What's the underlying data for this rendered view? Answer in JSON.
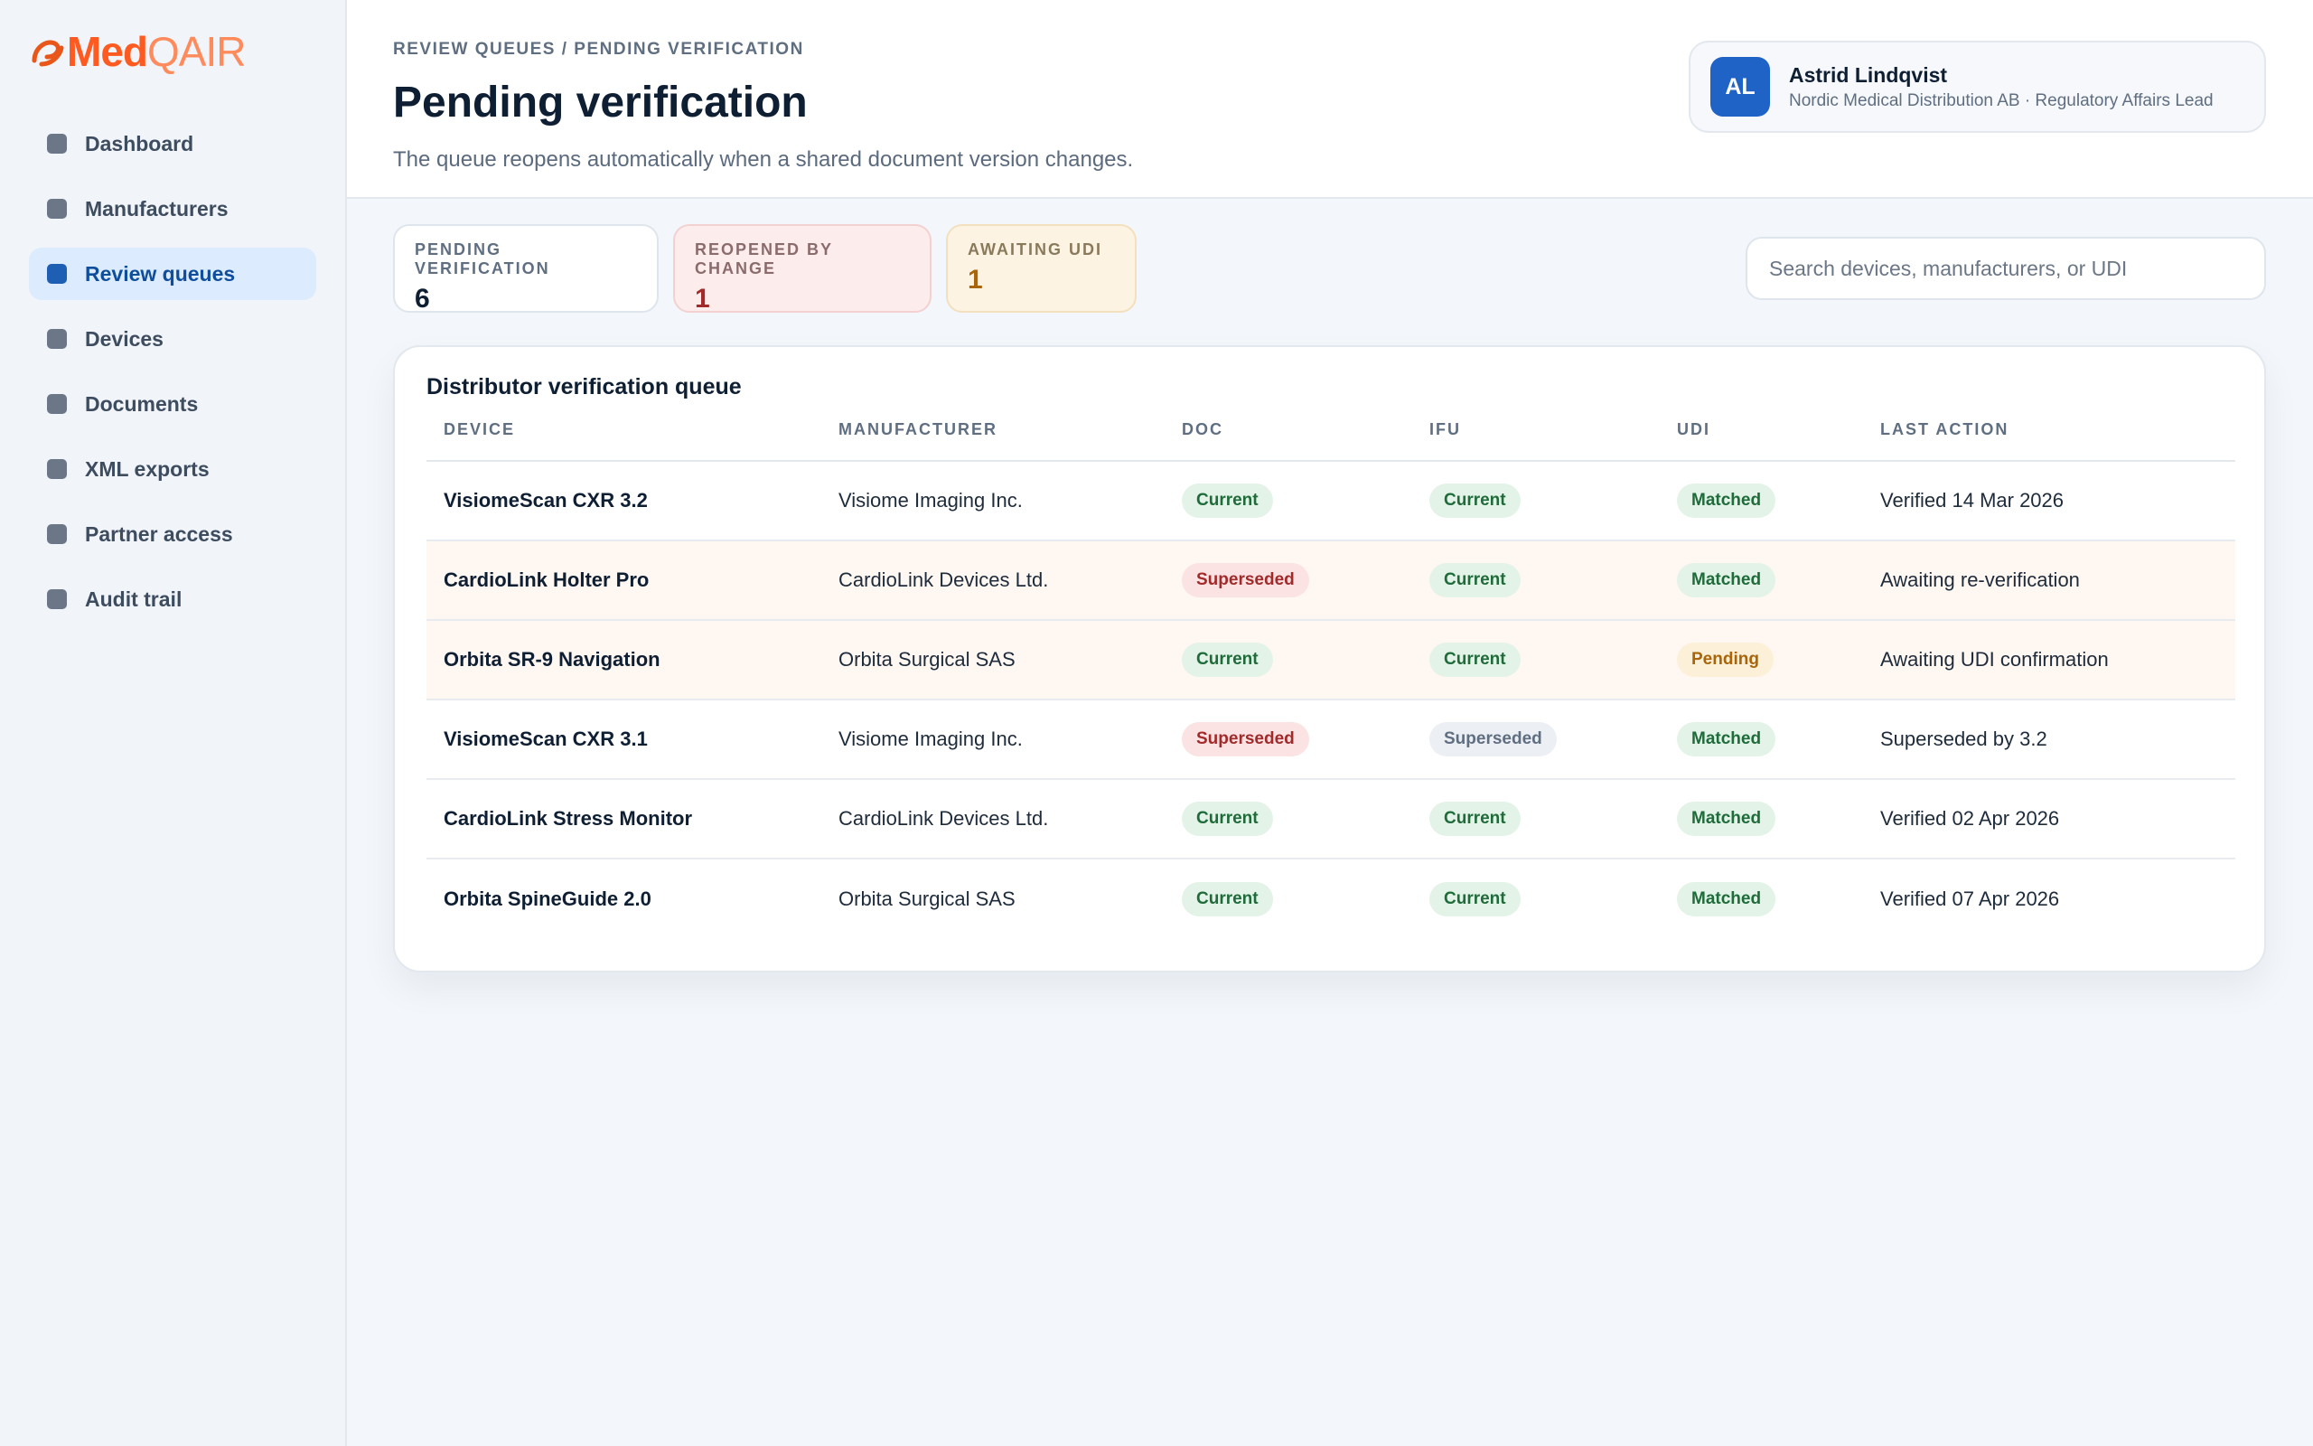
{
  "brand": {
    "name_part1": "Med",
    "name_part2": "QAIR",
    "colors": {
      "primary": "#ff5a1f",
      "secondary": "#ff8a5c"
    }
  },
  "sidebar": {
    "items": [
      {
        "label": "Dashboard",
        "active": false
      },
      {
        "label": "Manufacturers",
        "active": false
      },
      {
        "label": "Review queues",
        "active": true
      },
      {
        "label": "Devices",
        "active": false
      },
      {
        "label": "Documents",
        "active": false
      },
      {
        "label": "XML exports",
        "active": false
      },
      {
        "label": "Partner access",
        "active": false
      },
      {
        "label": "Audit trail",
        "active": false
      }
    ]
  },
  "header": {
    "breadcrumb": "REVIEW QUEUES / PENDING VERIFICATION",
    "title": "Pending verification",
    "subtitle": "The queue reopens automatically when a shared document version changes."
  },
  "user": {
    "initials": "AL",
    "name": "Astrid Lindqvist",
    "org": "Nordic Medical Distribution AB · Regulatory Affairs Lead"
  },
  "stats": [
    {
      "label": "PENDING VERIFICATION",
      "value": "6"
    },
    {
      "label": "REOPENED BY CHANGE",
      "value": "1"
    },
    {
      "label": "AWAITING UDI",
      "value": "1"
    }
  ],
  "search": {
    "placeholder": "Search devices, manufacturers, or UDI",
    "value": ""
  },
  "table": {
    "title": "Distributor verification queue",
    "columns": [
      "DEVICE",
      "MANUFACTURER",
      "DOC",
      "IFU",
      "UDI",
      "LAST ACTION"
    ],
    "rows": [
      {
        "device": "VisiomeScan CXR 3.2",
        "manufacturer": "Visiome Imaging Inc.",
        "doc": "Current",
        "ifu": "Current",
        "udi": "Matched",
        "last_action": "Verified 14 Mar 2026"
      },
      {
        "device": "CardioLink Holter Pro",
        "manufacturer": "CardioLink Devices Ltd.",
        "doc": "Superseded",
        "ifu": "Current",
        "udi": "Matched",
        "last_action": "Awaiting re-verification"
      },
      {
        "device": "Orbita SR-9 Navigation",
        "manufacturer": "Orbita Surgical SAS",
        "doc": "Current",
        "ifu": "Current",
        "udi": "Pending",
        "last_action": "Awaiting UDI confirmation"
      },
      {
        "device": "VisiomeScan CXR 3.1",
        "manufacturer": "Visiome Imaging Inc.",
        "doc": "Superseded",
        "ifu": "Superseded",
        "udi": "Matched",
        "last_action": "Superseded by 3.2"
      },
      {
        "device": "CardioLink Stress Monitor",
        "manufacturer": "CardioLink Devices Ltd.",
        "doc": "Current",
        "ifu": "Current",
        "udi": "Matched",
        "last_action": "Verified 02 Apr 2026"
      },
      {
        "device": "Orbita SpineGuide 2.0",
        "manufacturer": "Orbita Surgical SAS",
        "doc": "Current",
        "ifu": "Current",
        "udi": "Matched",
        "last_action": "Verified 07 Apr 2026"
      }
    ]
  }
}
